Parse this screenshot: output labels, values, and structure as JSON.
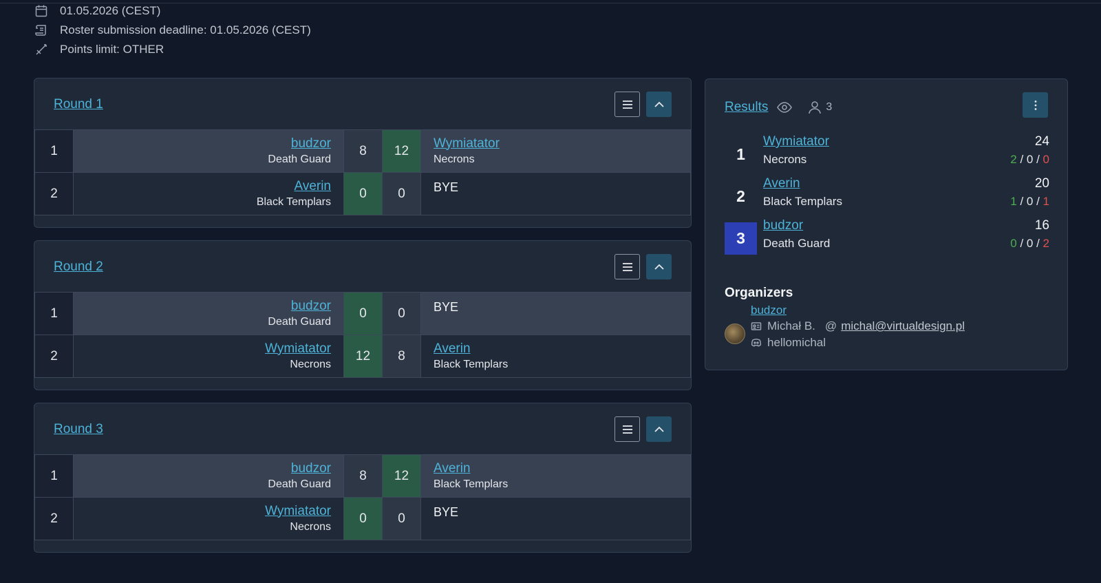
{
  "info": {
    "date": "01.05.2026 (CEST)",
    "deadline": "Roster submission deadline: 01.05.2026 (CEST)",
    "points": "Points limit: OTHER"
  },
  "rounds": [
    {
      "title": "Round 1",
      "pairings": [
        {
          "table": "1",
          "p1": "budzor",
          "p1_faction": "Death Guard",
          "s1": "8",
          "s2": "12",
          "p2": "Wymiatator",
          "p2_faction": "Necrons"
        },
        {
          "table": "2",
          "p1": "Averin",
          "p1_faction": "Black Templars",
          "s1": "0",
          "s2": "0",
          "p2": "BYE",
          "p2_faction": ""
        }
      ]
    },
    {
      "title": "Round 2",
      "pairings": [
        {
          "table": "1",
          "p1": "budzor",
          "p1_faction": "Death Guard",
          "s1": "0",
          "s2": "0",
          "p2": "BYE",
          "p2_faction": ""
        },
        {
          "table": "2",
          "p1": "Wymiatator",
          "p1_faction": "Necrons",
          "s1": "12",
          "s2": "8",
          "p2": "Averin",
          "p2_faction": "Black Templars"
        }
      ]
    },
    {
      "title": "Round 3",
      "pairings": [
        {
          "table": "1",
          "p1": "budzor",
          "p1_faction": "Death Guard",
          "s1": "8",
          "s2": "12",
          "p2": "Averin",
          "p2_faction": "Black Templars"
        },
        {
          "table": "2",
          "p1": "Wymiatator",
          "p1_faction": "Necrons",
          "s1": "0",
          "s2": "0",
          "p2": "BYE",
          "p2_faction": ""
        }
      ]
    }
  ],
  "results": {
    "title": "Results",
    "participants": "3",
    "standings": [
      {
        "rank": "1",
        "name": "Wymiatator",
        "faction": "Necrons",
        "points": "24",
        "w": "2",
        "d": "0",
        "l": "0"
      },
      {
        "rank": "2",
        "name": "Averin",
        "faction": "Black Templars",
        "points": "20",
        "w": "1",
        "d": "0",
        "l": "1"
      },
      {
        "rank": "3",
        "name": "budzor",
        "faction": "Death Guard",
        "points": "16",
        "w": "0",
        "d": "0",
        "l": "2"
      }
    ]
  },
  "organizers": {
    "title": "Organizers",
    "username": "budzor",
    "real_name": "Michał B.",
    "email": "michal@virtualdesign.pl",
    "discord": "hellomichal"
  },
  "colors": {
    "background": "#111827",
    "card": "#1f2937",
    "link": "#4eb3d9",
    "winner_score": "#2a5b46",
    "accent_button": "#25506a",
    "highlight_rank": "#2c3fb4",
    "win_count": "#4caf50",
    "loss_count": "#e05252"
  }
}
